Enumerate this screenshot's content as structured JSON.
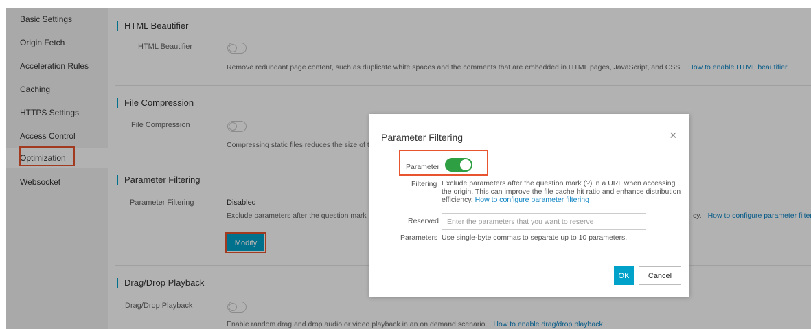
{
  "sidebar": {
    "items": [
      {
        "label": "Basic Settings"
      },
      {
        "label": "Origin Fetch"
      },
      {
        "label": "Acceleration Rules"
      },
      {
        "label": "Caching"
      },
      {
        "label": "HTTPS Settings"
      },
      {
        "label": "Access Control"
      },
      {
        "label": "Optimization",
        "active": true
      },
      {
        "label": "Websocket"
      }
    ]
  },
  "sections": {
    "html_beautifier": {
      "title": "HTML Beautifier",
      "label": "HTML Beautifier",
      "enabled": false,
      "description": "Remove redundant page content, such as duplicate white spaces and the comments that are embedded in HTML pages, JavaScript, and CSS.",
      "link": "How to enable HTML beautifier"
    },
    "file_compression": {
      "title": "File Compression",
      "label": "File Compression",
      "enabled": false,
      "description": "Compressing static files reduces the size of tra"
    },
    "parameter_filtering": {
      "title": "Parameter Filtering",
      "label": "Parameter Filtering",
      "status": "Disabled",
      "description": "Exclude parameters after the question mark (?)",
      "desc_tail": "cy.",
      "link": "How to configure parameter filtering",
      "modify_label": "Modify"
    },
    "drag_drop": {
      "title": "Drag/Drop Playback",
      "label": "Drag/Drop Playback",
      "enabled": false,
      "description": "Enable random drag and drop audio or video playback in an on demand scenario.",
      "link": "How to enable drag/drop playback"
    }
  },
  "modal": {
    "title": "Parameter Filtering",
    "close_icon": "×",
    "parameter_label": "Parameter",
    "filtering_label": "Filtering",
    "toggle_on": true,
    "filter_desc_lines": [
      "Exclude parameters after the question mark (?) in a URL when accessing",
      "the origin. This can improve the file cache hit ratio and enhance distribution"
    ],
    "filter_desc_last": "efficiency.",
    "filter_link": "How to configure parameter filtering",
    "reserved_label": "Reserved",
    "parameters_label": "Parameters",
    "input_placeholder": "Enter the parameters that you want to reserve",
    "input_value": "",
    "hint": "Use single-byte commas to separate up to 10 parameters.",
    "ok_label": "OK",
    "cancel_label": "Cancel"
  },
  "colors": {
    "accent": "#00a2ca",
    "highlight": "#e8542f",
    "toggle_on": "#2ea043",
    "link": "#0b83c3"
  }
}
